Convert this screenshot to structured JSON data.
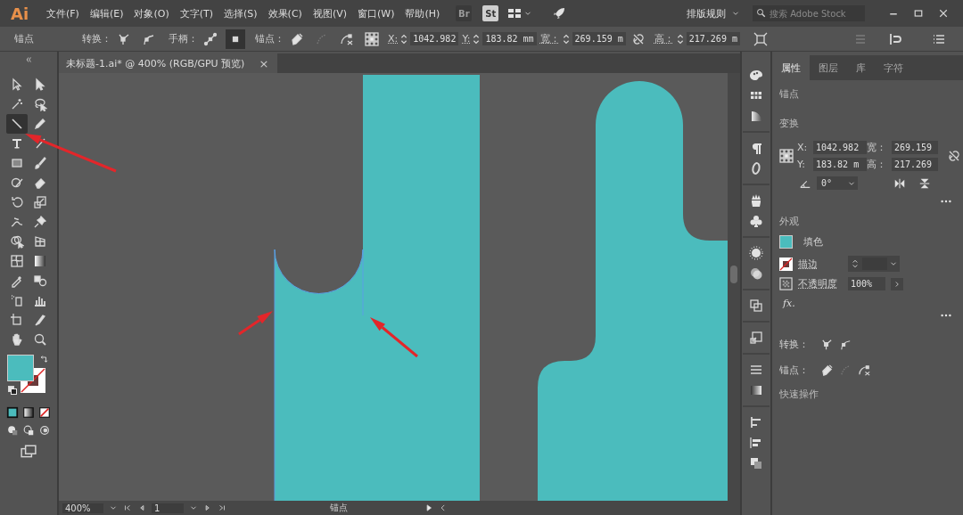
{
  "app": {
    "logo": "Ai"
  },
  "menu": [
    "文件(F)",
    "编辑(E)",
    "对象(O)",
    "文字(T)",
    "选择(S)",
    "效果(C)",
    "视图(V)",
    "窗口(W)",
    "帮助(H)"
  ],
  "apps": [
    {
      "label": "Br",
      "disabled": true
    },
    {
      "label": "St",
      "disabled": false
    }
  ],
  "workspace": "排版规则",
  "search": {
    "placeholder": "搜索 Adobe Stock"
  },
  "control_bar": {
    "selection": "锚点",
    "convert_label": "转换：",
    "handles_label": "手柄：",
    "handles": [
      {
        "selected": false
      },
      {
        "selected": true
      }
    ],
    "anchor_label": "锚点：",
    "anchor_tools": [
      {
        "disabled": false
      },
      {
        "disabled": true
      },
      {
        "disabled": false
      }
    ],
    "fields": [
      {
        "label": "X:",
        "value": "1042.982"
      },
      {
        "label": "Y:",
        "value": "183.82 mm"
      },
      {
        "label": "宽：",
        "value": "269.159 m"
      },
      {
        "label": "高：",
        "value": "217.269 m"
      }
    ]
  },
  "toolbar": {
    "tools": [
      {
        "selected": false
      },
      {
        "selected": false
      },
      {
        "selected": false
      },
      {
        "selected": false
      },
      {
        "selected": true
      },
      {
        "selected": false
      },
      {
        "selected": false
      },
      {
        "selected": false
      },
      {
        "selected": false
      },
      {
        "selected": false
      },
      {
        "selected": false
      },
      {
        "selected": false
      },
      {
        "selected": false
      },
      {
        "selected": false
      },
      {
        "selected": false
      },
      {
        "selected": false
      },
      {
        "selected": false
      },
      {
        "selected": false
      },
      {
        "selected": false
      },
      {
        "selected": false
      },
      {
        "selected": false
      },
      {
        "selected": false
      },
      {
        "selected": false
      },
      {
        "selected": false
      },
      {
        "selected": false
      },
      {
        "selected": false
      },
      {
        "selected": false
      },
      {
        "selected": false
      }
    ]
  },
  "document": {
    "tab": "未标题-1.ai* @ 400% (RGB/GPU 预览)",
    "close": "×"
  },
  "status_bar": {
    "zoom": "400%",
    "artboard": "1",
    "tool": "锚点"
  },
  "panel": {
    "tabs": [
      {
        "label": "属性",
        "selected": true
      },
      {
        "label": "图层",
        "selected": false
      },
      {
        "label": "库",
        "selected": false
      },
      {
        "label": "字符",
        "selected": false
      }
    ],
    "selection": "锚点",
    "transform_title": "变换",
    "fields": [
      {
        "label": "X:",
        "value": "1042.982"
      },
      {
        "label": "宽：",
        "value": "269.159"
      },
      {
        "label": "Y:",
        "value": "183.82 m"
      },
      {
        "label": "高：",
        "value": "217.269"
      }
    ],
    "angle": "0°",
    "appearance_title": "外观",
    "fill_label": "填色",
    "stroke_label": "描边",
    "opacity_label": "不透明度",
    "opacity": "100%",
    "fx": "fx.",
    "convert_label": "转换：",
    "anchor_label": "锚点：",
    "anchor_tools": [
      {
        "disabled": false
      },
      {
        "disabled": true
      },
      {
        "disabled": false
      }
    ],
    "quick_actions": "快速操作"
  }
}
